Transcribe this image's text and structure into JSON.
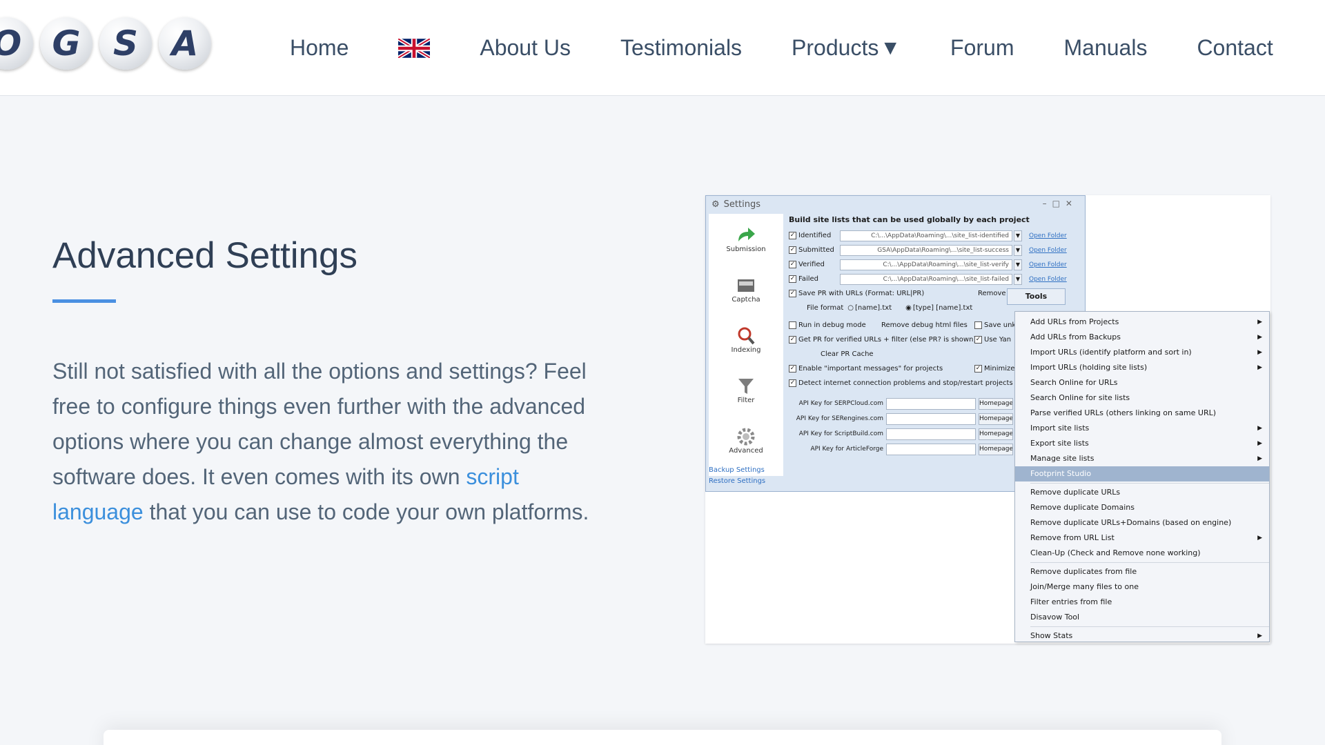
{
  "logo": {
    "letters": [
      "O",
      "G",
      "S",
      "A"
    ]
  },
  "nav": {
    "home": "Home",
    "about": "About Us",
    "testimonials": "Testimonials",
    "products": "Products",
    "forum": "Forum",
    "manuals": "Manuals",
    "contact": "Contact"
  },
  "section": {
    "title": "Advanced Settings",
    "body_before": "Still not satisfied with all the options and settings? Feel free to configure things even further with the advanced options where you can change almost everything the software does. It even comes with its own ",
    "link_text": "script language",
    "body_after": " that you can use to code your own platforms."
  },
  "screenshot": {
    "window_title": "Settings",
    "sidebar": [
      "Submission",
      "Captcha",
      "Indexing",
      "Filter",
      "Advanced"
    ],
    "sidebar_links": [
      "Backup Settings",
      "Restore Settings"
    ],
    "header": "Build site lists that can be used globally by each project",
    "lists": [
      {
        "label": "Identified",
        "path": "C:\\...\\AppData\\Roaming\\...\\site_list-identified"
      },
      {
        "label": "Submitted",
        "path": "GSA\\AppData\\Roaming\\...\\site_list-success"
      },
      {
        "label": "Verified",
        "path": "C:\\...\\AppData\\Roaming\\...\\site_list-verify"
      },
      {
        "label": "Failed",
        "path": "C:\\...\\AppData\\Roaming\\...\\site_list-failed"
      }
    ],
    "open_folder": "Open Folder",
    "save_pr": "Save PR with URLs (Format: URL|PR)",
    "remove": "Remove",
    "file_format": "File format",
    "fmt_a": "[name].txt",
    "fmt_b": "[type] [name].txt",
    "debug_mode": "Run in debug mode",
    "remove_debug": "Remove debug html files",
    "save_unk": "Save unk",
    "get_pr": "Get PR for verified URLs + filter (else PR? is shown)",
    "use_yan": "Use Yan",
    "clear_pr": "Clear PR Cache",
    "enable_msgs": "Enable \"important messages\" for projects",
    "minimize": "Minimize",
    "detect_net": "Detect internet connection problems and stop/restart projects",
    "api_keys": [
      {
        "label": "API Key for SERPCloud.com",
        "value": ""
      },
      {
        "label": "API Key for SERengines.com",
        "value": ""
      },
      {
        "label": "API Key for ScriptBuild.com",
        "value": ""
      },
      {
        "label": "API Key for ArticleForge",
        "value": ""
      }
    ],
    "homepage": "Homepage",
    "tools": "Tools",
    "menu": [
      {
        "label": "Add URLs from Projects",
        "arrow": true
      },
      {
        "label": "Add URLs from Backups",
        "arrow": true
      },
      {
        "label": "Import URLs (identify platform and sort in)",
        "arrow": true
      },
      {
        "label": "Import URLs (holding site lists)",
        "arrow": true
      },
      {
        "label": "Search Online for URLs",
        "arrow": false
      },
      {
        "label": "Search Online for site lists",
        "arrow": false
      },
      {
        "label": "Parse verified URLs (others linking on same URL)",
        "arrow": false
      },
      {
        "label": "Import site lists",
        "arrow": true
      },
      {
        "label": "Export site lists",
        "arrow": true
      },
      {
        "label": "Manage site lists",
        "arrow": true
      },
      {
        "label": "Footprint Studio",
        "arrow": false,
        "highlight": true
      },
      {
        "sep": true
      },
      {
        "label": "Remove duplicate URLs",
        "arrow": false
      },
      {
        "label": "Remove duplicate Domains",
        "arrow": false
      },
      {
        "label": "Remove duplicate URLs+Domains (based on engine)",
        "arrow": false
      },
      {
        "label": "Remove from URL List",
        "arrow": true
      },
      {
        "label": "Clean-Up (Check and Remove none working)",
        "arrow": false
      },
      {
        "sep": true
      },
      {
        "label": "Remove duplicates from file",
        "arrow": false
      },
      {
        "label": "Join/Merge many files to one",
        "arrow": false
      },
      {
        "label": "Filter entries from file",
        "arrow": false
      },
      {
        "label": "Disavow Tool",
        "arrow": false
      },
      {
        "sep": true
      },
      {
        "label": "Show Stats",
        "arrow": true
      }
    ]
  },
  "colors": {
    "accent": "#4a90e2",
    "link": "#3b8fdc",
    "title": "#2f3f55",
    "logo_text": "#2e3f66"
  },
  "icons": [
    "uk-flag-icon",
    "caret-down-icon",
    "arrow-right-icon",
    "captcha-icon",
    "indexing-icon",
    "filter-icon",
    "gear-icon"
  ]
}
